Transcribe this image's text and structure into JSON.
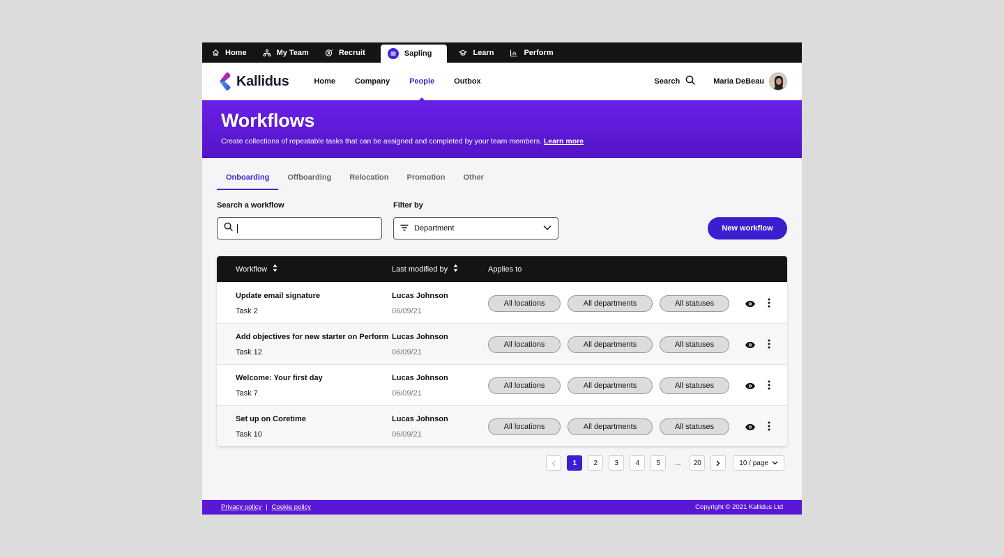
{
  "app_tabs": [
    {
      "label": "Home",
      "icon": "home-icon"
    },
    {
      "label": "My Team",
      "icon": "team-icon"
    },
    {
      "label": "Recruit",
      "icon": "recruit-icon"
    },
    {
      "label": "Sapling",
      "icon": "sapling-icon",
      "active": true
    },
    {
      "label": "Learn",
      "icon": "learn-icon"
    },
    {
      "label": "Perform",
      "icon": "perform-icon"
    }
  ],
  "brand": {
    "name": "Kallidus"
  },
  "main_nav": [
    "Home",
    "Company",
    "People",
    "Outbox"
  ],
  "main_nav_active": "People",
  "header": {
    "search_label": "Search",
    "user_name": "Maria DeBeau"
  },
  "hero": {
    "title": "Workflows",
    "description": "Create collections of repeatable tasks that can be assigned and completed by your team members.",
    "link": "Learn more"
  },
  "tabs": [
    "Onboarding",
    "Offboarding",
    "Relocation",
    "Promotion",
    "Other"
  ],
  "tabs_active": "Onboarding",
  "filters": {
    "search_label": "Search a workflow",
    "filter_label": "Filter by",
    "filter_value": "Department",
    "new_button": "New workflow"
  },
  "table": {
    "headers": {
      "workflow": "Workflow",
      "modified": "Last modified by",
      "applies": "Applies to"
    },
    "rows": [
      {
        "title": "Update email signature",
        "tasks": "Task 2",
        "user": "Lucas Johnson",
        "date": "06/09/21",
        "locations": "All locations",
        "departments": "All departments",
        "statuses": "All statuses"
      },
      {
        "title": "Add objectives for new starter on Perform",
        "tasks": "Task 12",
        "user": "Lucas Johnson",
        "date": "06/09/21",
        "locations": "All locations",
        "departments": "All departments",
        "statuses": "All statuses"
      },
      {
        "title": "Welcome: Your first day",
        "tasks": "Task 7",
        "user": "Lucas Johnson",
        "date": "06/09/21",
        "locations": "All locations",
        "departments": "All departments",
        "statuses": "All statuses"
      },
      {
        "title": "Set up on Coretime",
        "tasks": "Task 10",
        "user": "Lucas Johnson",
        "date": "06/09/21",
        "locations": "All locations",
        "departments": "All departments",
        "statuses": "All statuses"
      }
    ]
  },
  "pagination": {
    "pages": [
      "1",
      "2",
      "3",
      "4",
      "5"
    ],
    "ellipsis": "...",
    "last": "20",
    "current": "1",
    "per_page": "10 / page"
  },
  "footer": {
    "privacy": "Privacy policy",
    "separator": "|",
    "cookie": "Cookie policy",
    "copyright": "Copyright © 2021 Kallidus Ltd"
  },
  "colors": {
    "accent": "#3a1fd0",
    "hero": "#6a20e6",
    "appbar": "#141414"
  }
}
